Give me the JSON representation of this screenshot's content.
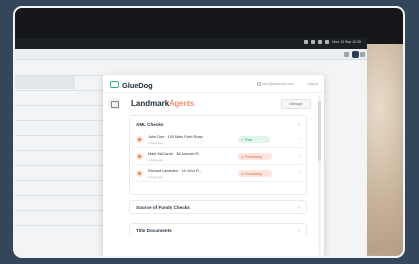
{
  "menubar": {
    "clock": "Mon 13 Sep 10:30"
  },
  "app": {
    "logo_text": "GlueDog",
    "user_email": "user@example.com",
    "logout_label": "Logout"
  },
  "page": {
    "title_prefix": "Landmark",
    "title_suffix": "Agents",
    "manage_label": "Manage"
  },
  "sections": {
    "aml": {
      "title": "AML Checks",
      "rows": [
        {
          "name": "John Doe · 100 Main Field Road",
          "sub": "2 days ago",
          "status": "Pass",
          "status_type": "pass"
        },
        {
          "name": "Mark McCarrie · 38 Arundel R...",
          "sub": "2 days ago",
          "status": "Processing",
          "status_type": "processing"
        },
        {
          "name": "Richard Lambden · 15 John Fi...",
          "sub": "2 days ago",
          "status": "Processing",
          "status_type": "processing"
        }
      ]
    },
    "sof": {
      "title": "Source of Funds Checks"
    },
    "docs": {
      "title": "Title Documents"
    }
  },
  "icons": {
    "status_pass": "check-icon",
    "status_processing": "clock-icon",
    "row": "person-icon"
  },
  "colors": {
    "accent_green": "#2fb47c",
    "accent_orange": "#f26b3a",
    "background": "#33465a"
  }
}
